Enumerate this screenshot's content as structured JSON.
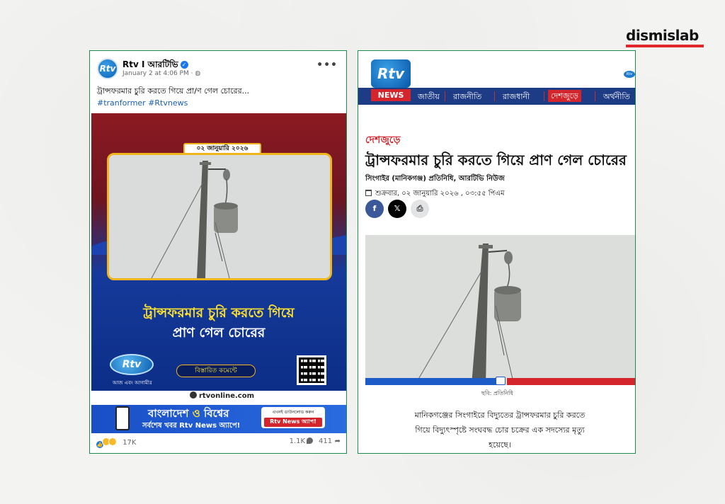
{
  "brand": {
    "name": "dismislab",
    "accent": "#e3262c"
  },
  "facebook_post": {
    "page_name": "Rtv I আরটিভি",
    "timestamp": "January 2 at 4:06 PM",
    "caption": "ট্রান্সফরমার চুরি করতে গিয়ে প্রা/ণ গেল চোরের...",
    "hashtags": "#tranformer #Rtvnews",
    "more_icon": "•••",
    "image": {
      "date_tag": "০২ জানুয়ারি ২০২৬",
      "headline_line1": "ট্রান্সফরমার চুরি করতে গিয়ে",
      "headline_line2": "প্রাণ গেল চোরের",
      "logo_text": "Rtv",
      "tagline": "আজ এবং আগামীর",
      "details_button": "বিস্তারিত কমেন্টে",
      "website": "rtvonline.com"
    },
    "ad": {
      "title_part1": "বাংলাদেশ",
      "title_amp": "ও",
      "title_part2": "বিশ্বের",
      "subtitle": "সর্বশেষ খবর Rtv News অ্যাপে!",
      "cta_top": "এখনই ডাউনলোড করুন",
      "cta_main": "Rtv News অ্যাপ!"
    },
    "reactions_count": "17K",
    "comments_count": "1.1K",
    "shares_count": "411"
  },
  "news_article": {
    "logo_text": "Rtv",
    "logo_bar": "NEWS",
    "nav_items": [
      {
        "label": "জাতীয়",
        "active": false
      },
      {
        "label": "রাজনীতি",
        "active": false
      },
      {
        "label": "রাজধানী",
        "active": false
      },
      {
        "label": "দেশজুড়ে",
        "active": true
      },
      {
        "label": "অর্থনীতি",
        "active": false
      }
    ],
    "category": "দেশজুড়ে",
    "title": "ট্রান্সফরমার চুরি করতে গিয়ে প্রাণ গেল চোরের",
    "byline": "সিংগাইর (মানিকগঞ্জ) প্রতিনিধি, আরটিভি নিউজ",
    "date": "শুক্রবার, ০২ জানুয়ারি ২০২৬ , ০৩:৫৫ পিএম",
    "share": {
      "facebook": "f",
      "x": "𝕏",
      "print": "⎙"
    },
    "photo_credit": "ছবি: প্রতিনিধি",
    "body": "মানিকগঞ্জের সিংগাইরে বিদ্যুতের ট্রান্সফরমার চুরি করতে গিয়ে বিদ্যুৎস্পৃষ্টে সংঘবদ্ধ চোর চক্রের এক সদস্যের মৃত্যু হয়েছে।"
  },
  "colors": {
    "card_border": "#1f8a52",
    "fb_link": "#1a5fb4",
    "rtv_red": "#d3252b",
    "rtv_blue": "#1e3b86",
    "headline_yellow": "#ffe22f"
  }
}
